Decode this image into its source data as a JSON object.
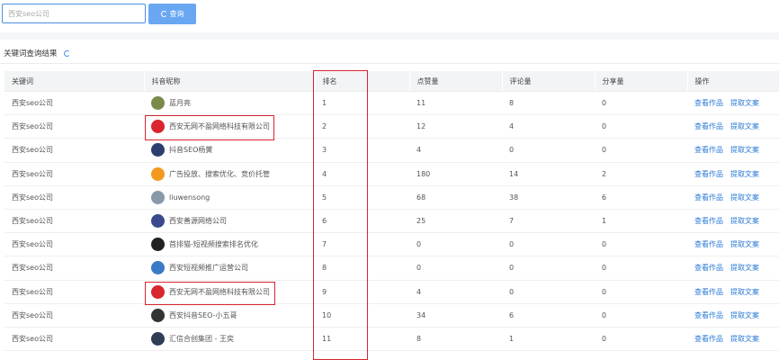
{
  "search": {
    "placeholder": "西安seo公司",
    "button_label": "查询"
  },
  "result_title": "关键词查询结果",
  "table": {
    "headers": [
      "关键词",
      "抖音昵称",
      "排名",
      "点赞量",
      "评论量",
      "分享量",
      "操作"
    ],
    "actions": [
      "查看作品",
      "提取文案"
    ],
    "rows": [
      {
        "keyword": "西安seo公司",
        "nickname": "蓝月亮",
        "rank": "1",
        "likes": "11",
        "comments": "8",
        "shares": "0",
        "avatar_color": "#7a8a4a"
      },
      {
        "keyword": "西安seo公司",
        "nickname": "西安无网不盈网络科技有限公司",
        "rank": "2",
        "likes": "12",
        "comments": "4",
        "shares": "0",
        "avatar_color": "#d9252e"
      },
      {
        "keyword": "西安seo公司",
        "nickname": "抖音SEO杨黉",
        "rank": "3",
        "likes": "4",
        "comments": "0",
        "shares": "0",
        "avatar_color": "#2c3e6b"
      },
      {
        "keyword": "西安seo公司",
        "nickname": "广告投放、搜索优化、竞价托管",
        "rank": "4",
        "likes": "180",
        "comments": "14",
        "shares": "2",
        "avatar_color": "#f39a1e"
      },
      {
        "keyword": "西安seo公司",
        "nickname": "liuwensong",
        "rank": "5",
        "likes": "68",
        "comments": "38",
        "shares": "6",
        "avatar_color": "#8899aa"
      },
      {
        "keyword": "西安seo公司",
        "nickname": "西安善源网络公司",
        "rank": "6",
        "likes": "25",
        "comments": "7",
        "shares": "1",
        "avatar_color": "#3b4a8c"
      },
      {
        "keyword": "西安seo公司",
        "nickname": "首排猫-短视频搜索排名优化",
        "rank": "7",
        "likes": "0",
        "comments": "0",
        "shares": "0",
        "avatar_color": "#222222"
      },
      {
        "keyword": "西安seo公司",
        "nickname": "西安短视频推广运营公司",
        "rank": "8",
        "likes": "0",
        "comments": "0",
        "shares": "0",
        "avatar_color": "#3a7bc8"
      },
      {
        "keyword": "西安seo公司",
        "nickname": "西安无网不盈网络科技有限公司",
        "rank": "9",
        "likes": "4",
        "comments": "0",
        "shares": "0",
        "avatar_color": "#d9252e"
      },
      {
        "keyword": "西安seo公司",
        "nickname": "西安抖音SEO-小五哥",
        "rank": "10",
        "likes": "34",
        "comments": "6",
        "shares": "0",
        "avatar_color": "#333333"
      },
      {
        "keyword": "西安seo公司",
        "nickname": "汇信合创集团 - 王奕",
        "rank": "11",
        "likes": "8",
        "comments": "1",
        "shares": "0",
        "avatar_color": "#2f3d55"
      }
    ]
  },
  "colors": {
    "accent": "#6aa7f2",
    "link": "#2a7ad6",
    "highlight": "#d9252e"
  }
}
